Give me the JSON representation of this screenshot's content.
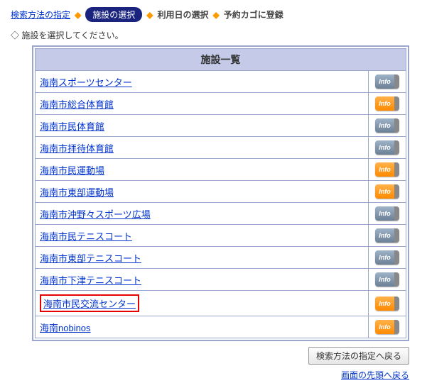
{
  "breadcrumb": {
    "step1": "検索方法の指定",
    "step2": "施設の選択",
    "step3": "利用日の選択",
    "step4": "予約カゴに登録"
  },
  "instruction": "◇ 施設を選択してください。",
  "table_header": "施設一覧",
  "info_label": "Info",
  "rows": [
    {
      "name": "海南スポーツセンター",
      "variant": "gray"
    },
    {
      "name": "海南市総合体育館",
      "variant": "orange"
    },
    {
      "name": "海南市民体育館",
      "variant": "gray"
    },
    {
      "name": "海南市拝待体育館",
      "variant": "gray"
    },
    {
      "name": "海南市民運動場",
      "variant": "orange"
    },
    {
      "name": "海南市東部運動場",
      "variant": "orange"
    },
    {
      "name": "海南市沖野々スポーツ広場",
      "variant": "gray"
    },
    {
      "name": "海南市民テニスコート",
      "variant": "gray"
    },
    {
      "name": "海南市東部テニスコート",
      "variant": "gray"
    },
    {
      "name": "海南市下津テニスコート",
      "variant": "gray"
    },
    {
      "name": "海南市民交流センター",
      "variant": "orange",
      "highlight": true
    },
    {
      "name": "海南nobinos",
      "variant": "orange"
    }
  ],
  "back_button": "検索方法の指定へ戻る",
  "page_top_link": "画面の先頭へ戻る"
}
